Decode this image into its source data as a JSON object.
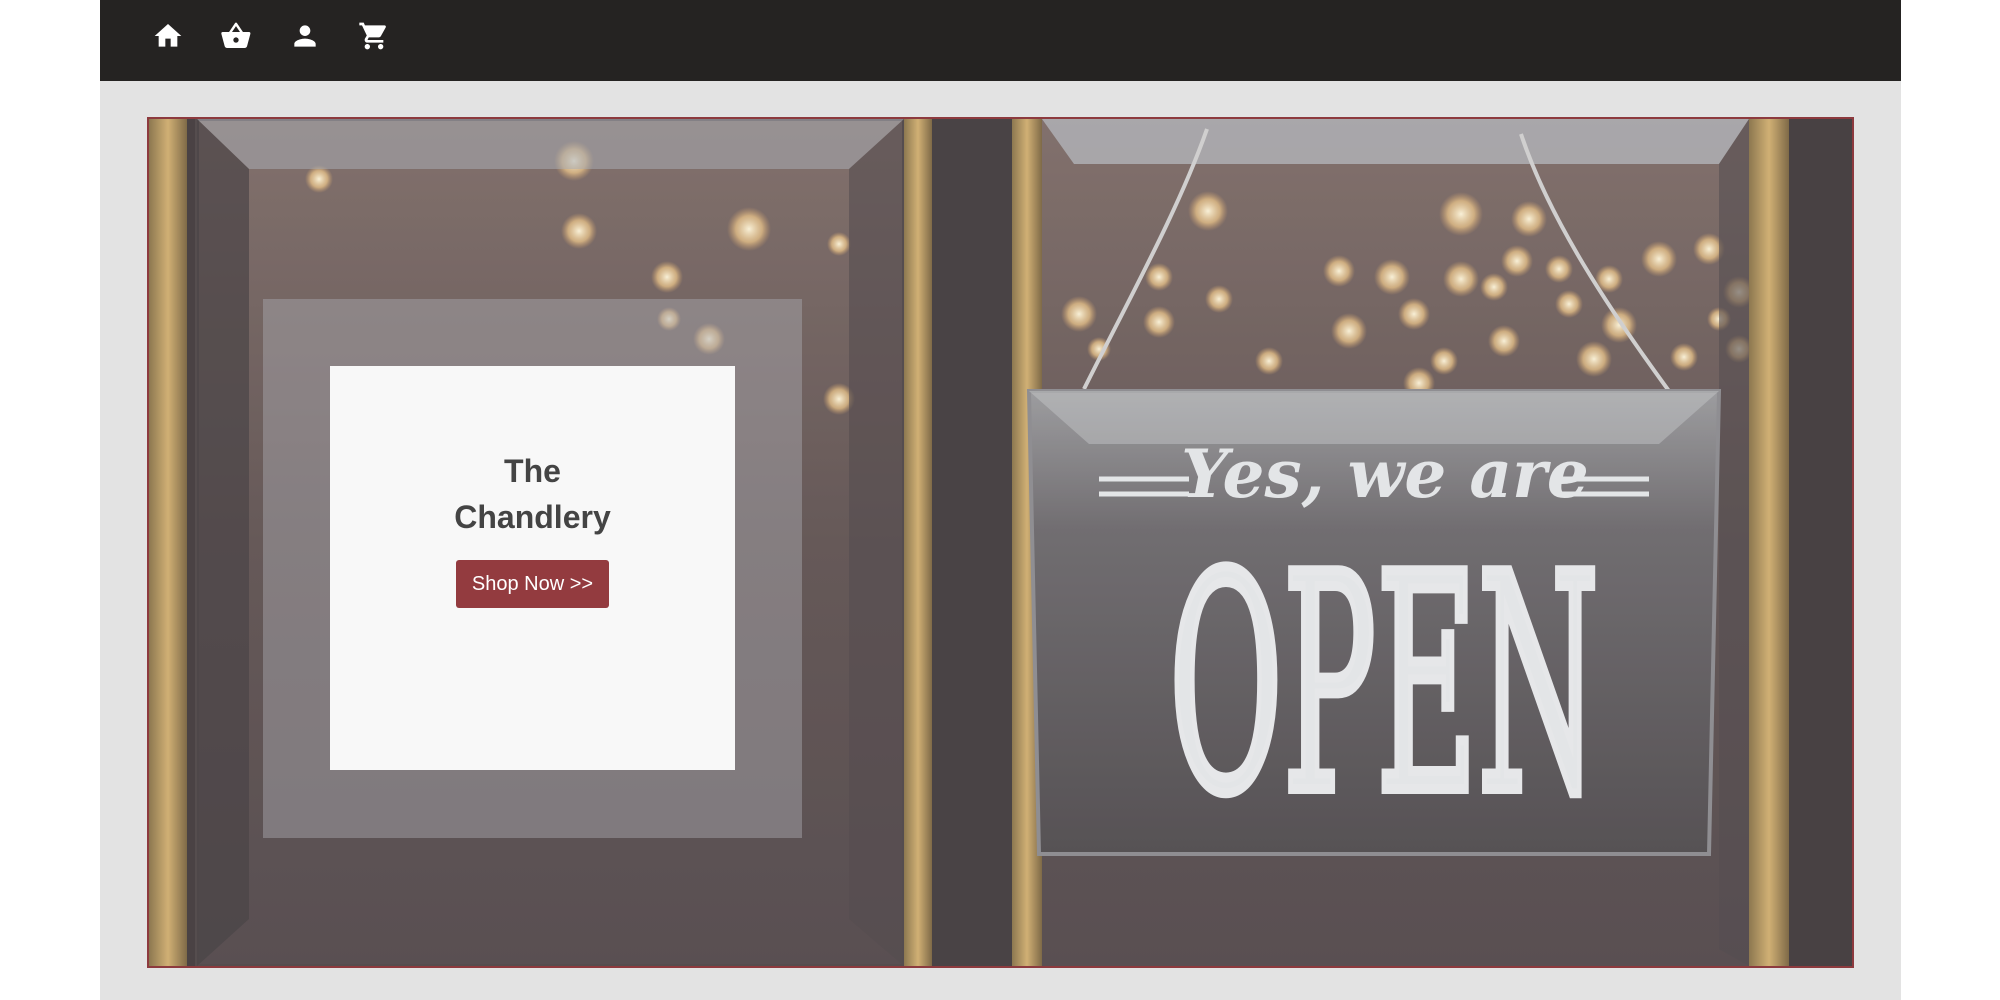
{
  "navbar": {
    "icons": [
      {
        "name": "home-icon",
        "label": "home"
      },
      {
        "name": "basket-icon",
        "label": "basket"
      },
      {
        "name": "user-icon",
        "label": "account"
      },
      {
        "name": "cart-icon",
        "label": "cart"
      }
    ]
  },
  "hero": {
    "title_line1": "The",
    "title_line2": "Chandlery",
    "button_label": "Shop Now >>",
    "sign_script": "Yes, we are",
    "sign_big": "OPEN"
  },
  "colors": {
    "navbar_bg": "#252322",
    "page_bg": "#e3e3e3",
    "accent": "#933b3f",
    "hero_border": "#8d3a3e"
  }
}
